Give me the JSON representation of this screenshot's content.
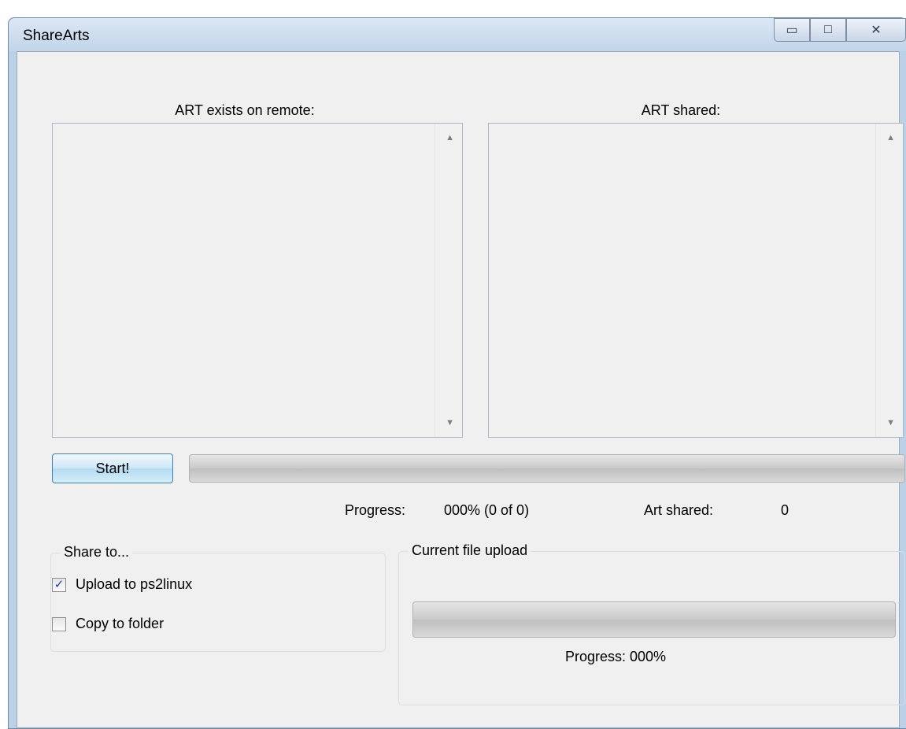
{
  "window": {
    "title": "ShareArts",
    "minimize_glyph": "▭",
    "maximize_glyph": "□",
    "close_glyph": "✕"
  },
  "lists": {
    "remote_label": "ART exists on remote:",
    "shared_label": "ART shared:",
    "scroll_up_glyph": "▲",
    "scroll_down_glyph": "▼"
  },
  "actions": {
    "start_label": "Start!"
  },
  "overall_progress": {
    "fraction": 0,
    "progress_label": "Progress:",
    "progress_value": "000% (0 of 0)",
    "shared_label": "Art shared:",
    "shared_value": "0"
  },
  "share_to": {
    "title": "Share to...",
    "options": [
      {
        "label": "Upload to ps2linux",
        "checked": true
      },
      {
        "label": "Copy to folder",
        "checked": false
      }
    ],
    "check_glyph": "✓"
  },
  "current_upload": {
    "title": "Current file upload",
    "fraction": 0,
    "progress_text": "Progress: 000%"
  }
}
